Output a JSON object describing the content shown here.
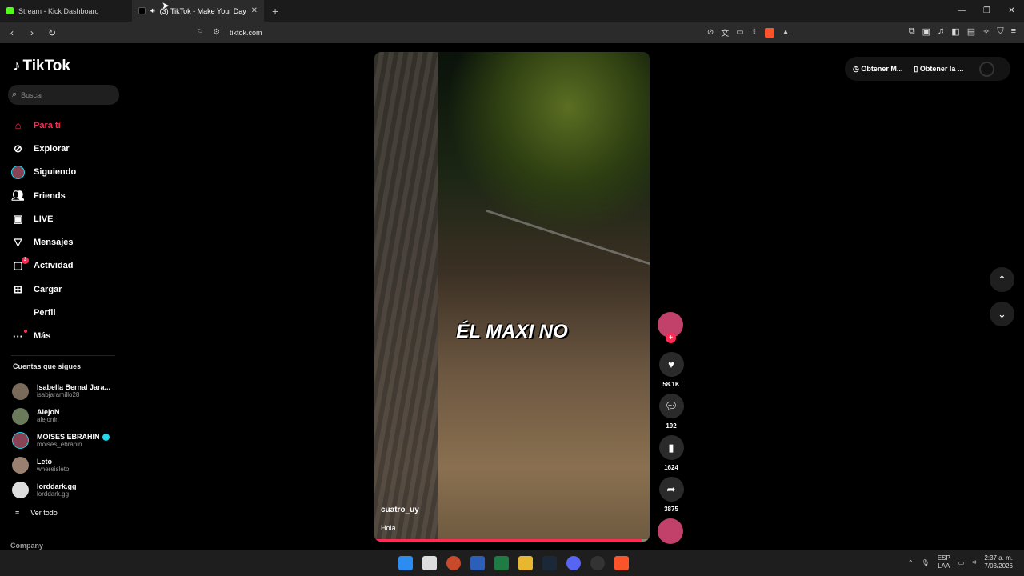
{
  "browser": {
    "tabs": [
      {
        "title": "Stream - Kick Dashboard",
        "favicon_color": "#53fc18",
        "active": false
      },
      {
        "title": "(3) TikTok - Make Your Day",
        "favicon_color": "#000000",
        "active": true
      }
    ],
    "new_tab_symbol": "+",
    "url": "tiktok.com"
  },
  "sidebar": {
    "logo": "TikTok",
    "search_placeholder": "Buscar",
    "menu": [
      {
        "label": "Para ti",
        "icon": "home-icon",
        "active": true
      },
      {
        "label": "Explorar",
        "icon": "compass-icon"
      },
      {
        "label": "Siguiendo",
        "icon": "following-avatar-icon"
      },
      {
        "label": "Friends",
        "icon": "friends-icon"
      },
      {
        "label": "LIVE",
        "icon": "live-icon"
      },
      {
        "label": "Mensajes",
        "icon": "messages-icon"
      },
      {
        "label": "Actividad",
        "icon": "activity-icon",
        "badge": "3"
      },
      {
        "label": "Cargar",
        "icon": "upload-icon"
      },
      {
        "label": "Perfil",
        "icon": "profile-icon"
      },
      {
        "label": "Más",
        "icon": "more-icon"
      }
    ],
    "following_title": "Cuentas que sigues",
    "accounts": [
      {
        "name": "Isabella Bernal Jara...",
        "handle": "isabjaramillo28",
        "verified": false
      },
      {
        "name": "AlejoN",
        "handle": "alejonin",
        "verified": false
      },
      {
        "name": "MOISES EBRAHIN",
        "handle": "moises_ebrahin",
        "verified": true
      },
      {
        "name": "Leto",
        "handle": "whereisleto",
        "verified": false
      },
      {
        "name": "lorddark.gg",
        "handle": "lorddark.gg",
        "verified": false
      }
    ],
    "see_all": "Ver todo",
    "company": "Company"
  },
  "video": {
    "caption": "ÉL MAXI NO",
    "username": "cuatro_uy",
    "description": "Hola",
    "progress": 0.97
  },
  "actions": {
    "likes": "58.1K",
    "comments": "192",
    "saves": "1624",
    "shares": "3875"
  },
  "top_right": {
    "get_coins": "Obtener M...",
    "get_app": "Obtener la ..."
  },
  "taskbar": {
    "lang_top": "ESP",
    "lang_bottom": "LAA",
    "time": "2:37 a. m.",
    "date": "7/03/2026"
  }
}
